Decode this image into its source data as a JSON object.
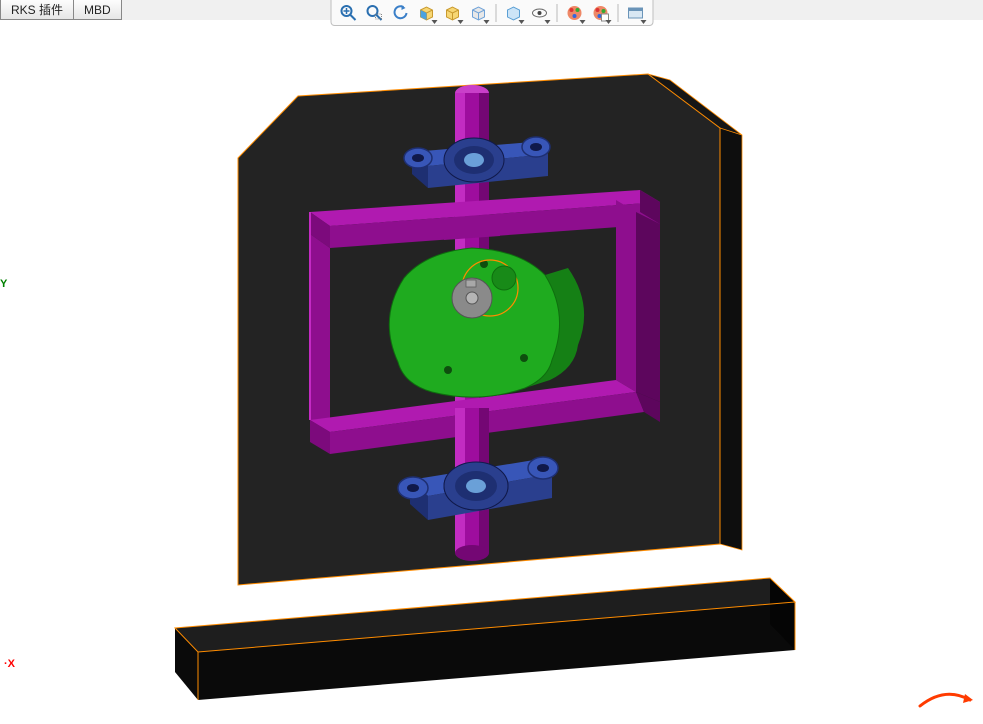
{
  "tabs": {
    "plugin_partial": "RKS 插件",
    "mbd": "MBD"
  },
  "toolbar": {
    "items": [
      {
        "name": "zoom-fit-icon"
      },
      {
        "name": "zoom-area-icon"
      },
      {
        "name": "previous-view-icon"
      },
      {
        "name": "section-view-icon"
      },
      {
        "name": "view-orientation-icon"
      },
      {
        "name": "display-style-icon"
      },
      {
        "sep": true
      },
      {
        "name": "hide-show-icon"
      },
      {
        "name": "edit-appearance-icon"
      },
      {
        "sep": true
      },
      {
        "name": "apply-scene-icon"
      },
      {
        "name": "view-settings-icon"
      },
      {
        "sep": true
      },
      {
        "name": "display-pane-icon"
      }
    ]
  },
  "statusbar": {
    "axis_x": "·X",
    "axis_y": "Y"
  },
  "model": {
    "colors": {
      "backplate": "#252525",
      "base": "#0e0e0e",
      "rod": "#9e0d9e",
      "frame": "#a20aa2",
      "bearing_body": "#3856b8",
      "bearing_dark": "#1e2f72",
      "cam": "#1fab1f",
      "cam_dark": "#158015",
      "hub": "#8a8a8a",
      "highlight": "#ff8c00"
    }
  }
}
